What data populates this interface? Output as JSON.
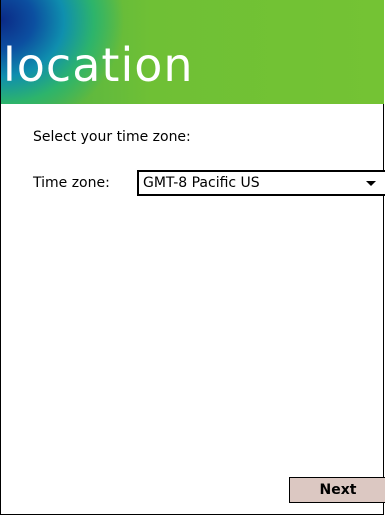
{
  "header": {
    "title": "location"
  },
  "content": {
    "prompt": "Select your time zone:",
    "time_zone_label": "Time zone:",
    "time_zone_value": "GMT-8 Pacific US"
  },
  "footer": {
    "next_label": "Next"
  },
  "colors": {
    "banner_green": "#74c334",
    "banner_blue": "#0b2a86",
    "button_face": "#dcc8c2"
  },
  "icons": {
    "dropdown": "chevron-down-icon"
  }
}
